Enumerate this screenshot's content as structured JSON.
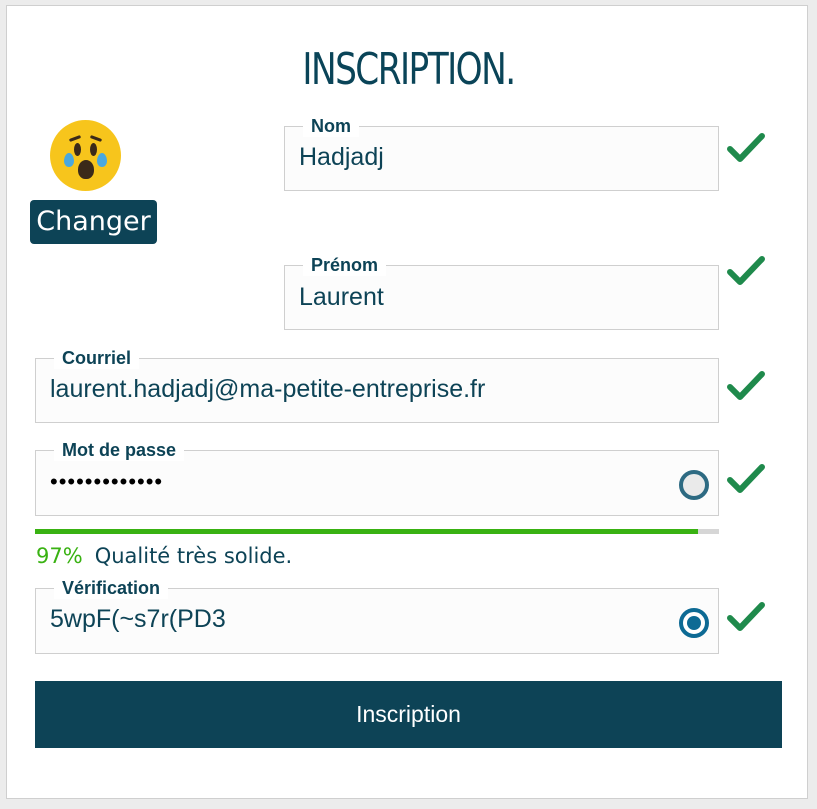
{
  "page_title": "INSCRIPTION.",
  "avatar": {
    "icon": "face-screaming-crying-emoji-icon"
  },
  "change_button": "Changer",
  "fields": {
    "nom": {
      "label": "Nom",
      "value": "Hadjadj",
      "valid": true
    },
    "prenom": {
      "label": "Prénom",
      "value": "Laurent",
      "valid": true
    },
    "courriel": {
      "label": "Courriel",
      "value": "laurent.hadjadj@ma-petite-entreprise.fr",
      "valid": true
    },
    "mot_de_passe": {
      "label": "Mot de passe",
      "value": "•••••••••••••",
      "visibility": "hidden",
      "valid": true
    },
    "verification": {
      "label": "Vérification",
      "value": "5wpF(~s7r(PD3",
      "visibility": "shown",
      "valid": true
    }
  },
  "password_strength": {
    "percent_label": "97%",
    "percent": 97,
    "text": "Qualité très solide.",
    "color": "#39b212"
  },
  "submit_button": "Inscription",
  "colors": {
    "primary": "#0d4356",
    "success": "#1f8a4c",
    "strength": "#39b212"
  }
}
